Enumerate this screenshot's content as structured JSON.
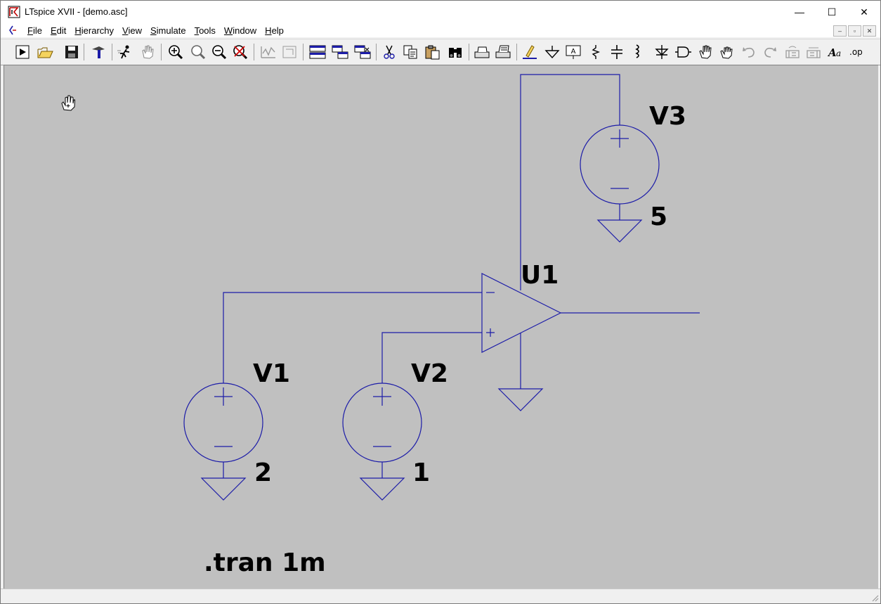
{
  "titlebar": {
    "title": "LTspice XVII - [demo.asc]",
    "minimize_glyph": "—",
    "maximize_glyph": "☐",
    "close_glyph": "✕"
  },
  "menu": [
    {
      "underline": "F",
      "rest": "ile"
    },
    {
      "underline": "E",
      "rest": "dit"
    },
    {
      "underline": "H",
      "rest": "ierarchy"
    },
    {
      "underline": "V",
      "rest": "iew"
    },
    {
      "underline": "S",
      "rest": "imulate"
    },
    {
      "underline": "T",
      "rest": "ools"
    },
    {
      "underline": "W",
      "rest": "indow"
    },
    {
      "underline": "H",
      "rest": "elp"
    }
  ],
  "mdi_buttons": [
    "–",
    "▫",
    "✕"
  ],
  "toolbar_icons": [
    "run-icon",
    "open-icon",
    "save-icon",
    "control-panel-icon",
    "halt-icon",
    "pan-icon",
    "zoom-in-icon",
    "zoom-fit-icon",
    "zoom-out-icon",
    "zoom-cancel-icon",
    "autorange-icon",
    "tile-disabled-icon",
    "tile-horizontal-icon",
    "cascade-icon",
    "close-all-icon",
    "cut-icon",
    "copy-icon",
    "paste-icon",
    "find-icon",
    "print-icon",
    "print-preview-icon",
    "draw-wire-icon",
    "ground-icon",
    "label-net-icon",
    "resistor-icon",
    "capacitor-icon",
    "inductor-icon",
    "diode-icon",
    "component-icon",
    "move-icon",
    "drag-icon",
    "undo-icon",
    "redo-icon",
    "rotate-icon",
    "mirror-icon",
    "text-icon",
    "spice-directive-icon"
  ],
  "schematic": {
    "wire_color": "#1c1ca8",
    "background": "#c0c0c0",
    "components": {
      "V1": {
        "name": "V1",
        "value": "2"
      },
      "V2": {
        "name": "V2",
        "value": "1"
      },
      "V3": {
        "name": "V3",
        "value": "5"
      },
      "U1": {
        "name": "U1"
      }
    },
    "directive": ".tran 1m",
    "opamp_minus": "−",
    "opamp_plus": "+"
  }
}
